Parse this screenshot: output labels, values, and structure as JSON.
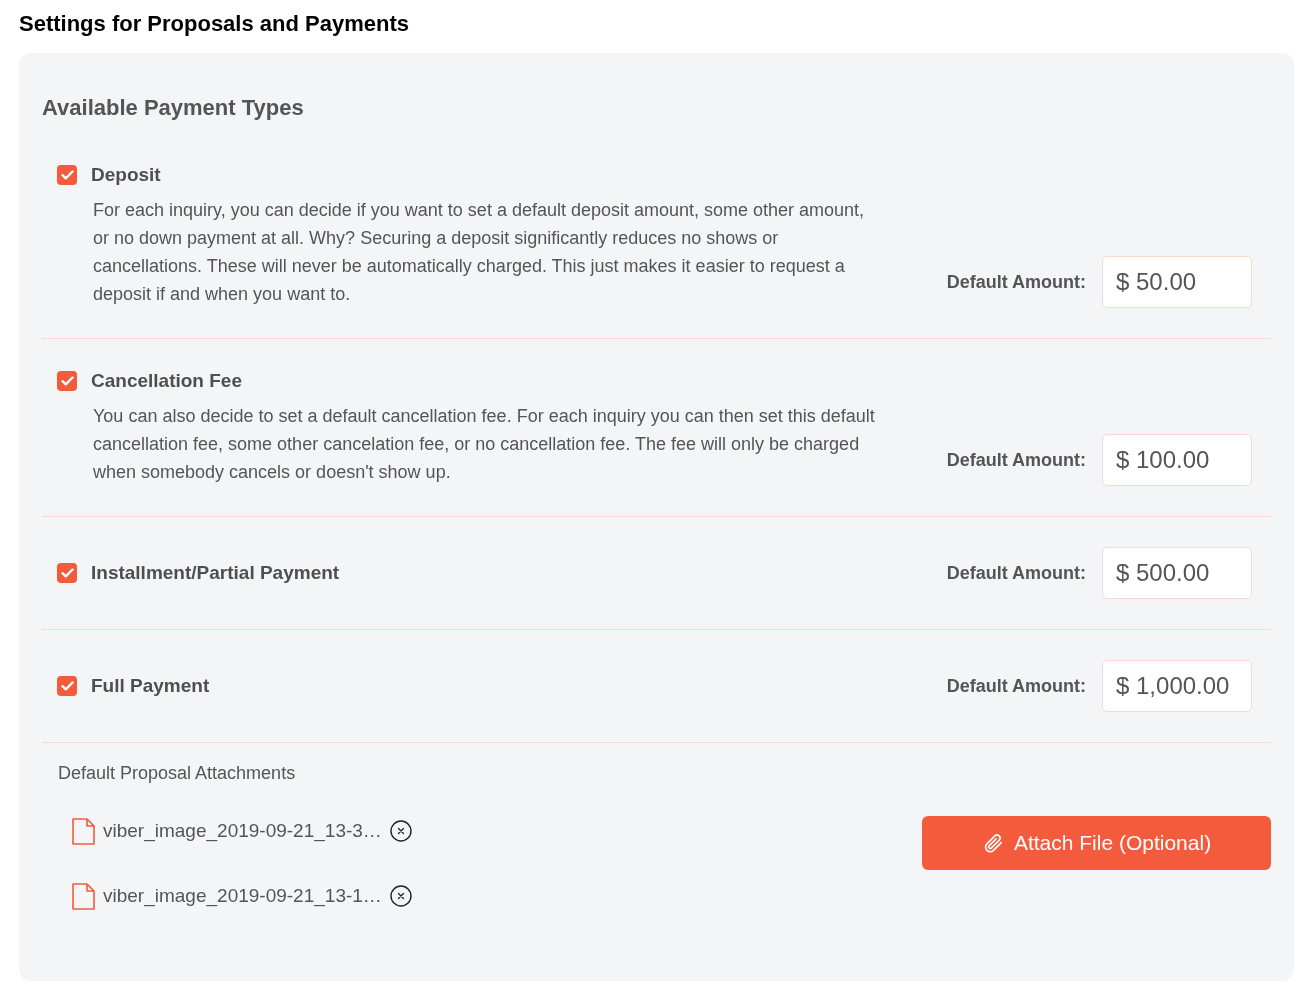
{
  "title": "Settings for Proposals and Payments",
  "section_heading": "Available Payment Types",
  "payment_types": [
    {
      "label": "Deposit",
      "checked": true,
      "description": "For each inquiry, you can decide if you want to set a default deposit amount, some other amount, or no down payment at all. Why? Securing a deposit significantly reduces no shows or cancellations. These will never be automatically charged. This just makes it easier to request a deposit if and when you want to.",
      "amount_label": "Default Amount:",
      "amount": "$ 50.00"
    },
    {
      "label": "Cancellation Fee",
      "checked": true,
      "description": "You can also decide to set a default cancellation fee. For each inquiry you can then set this default cancellation fee, some other cancelation fee, or no cancellation fee. The fee will only be charged when somebody cancels or doesn't show up.",
      "amount_label": "Default Amount:",
      "amount": "$ 100.00"
    },
    {
      "label": "Installment/Partial Payment",
      "checked": true,
      "amount_label": "Default Amount:",
      "amount": "$ 500.00"
    },
    {
      "label": "Full Payment",
      "checked": true,
      "amount_label": "Default Amount:",
      "amount": "$ 1,000.00"
    }
  ],
  "attachments": {
    "heading": "Default Proposal Attachments",
    "files": [
      {
        "name": "viber_image_2019-09-21_13-3…"
      },
      {
        "name": "viber_image_2019-09-21_13-1…"
      }
    ],
    "attach_button": "Attach File (Optional)"
  }
}
